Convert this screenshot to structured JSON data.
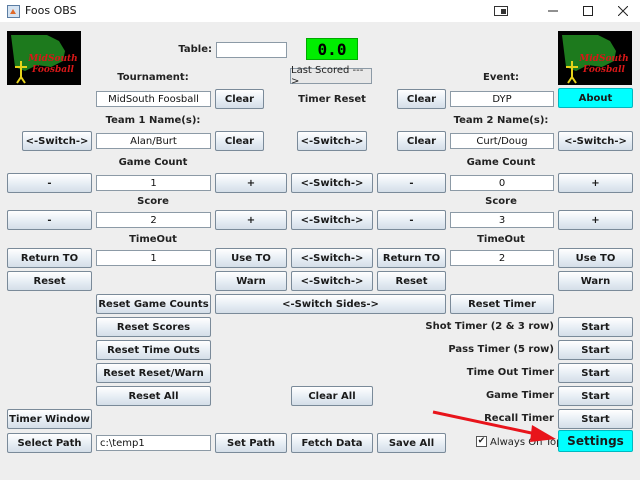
{
  "window": {
    "title": "Foos OBS"
  },
  "header": {
    "table_label": "Table:",
    "table_value": "",
    "score": "0.0",
    "tournament_label": "Tournament:",
    "event_label": "Event:",
    "last_scored": "Last Scored --->",
    "timer_reset": "Timer Reset",
    "about": "About"
  },
  "logo": {
    "line1": "MidSouth",
    "line2": "Foosball"
  },
  "tournament": {
    "value": "MidSouth Foosball",
    "clear": "Clear"
  },
  "event": {
    "clear": "Clear",
    "value": "DYP"
  },
  "team1": {
    "label": "Team 1 Name(s):",
    "switch": "<-Switch->",
    "value": "Alan/Burt",
    "clear": "Clear"
  },
  "team2": {
    "label": "Team 2 Name(s):",
    "switch": "<-Switch->",
    "value": "Curt/Doug",
    "clear": "Clear"
  },
  "center": {
    "switch_names": "<-Switch->"
  },
  "game_count": {
    "label1": "Game Count",
    "label2": "Game Count",
    "minus1": "-",
    "value1": "1",
    "plus1": "+",
    "switch": "<-Switch->",
    "minus2": "-",
    "value2": "0",
    "plus2": "+"
  },
  "score": {
    "label1": "Score",
    "label2": "Score",
    "minus1": "-",
    "value1": "2",
    "plus1": "+",
    "switch": "<-Switch->",
    "minus2": "-",
    "value2": "3",
    "plus2": "+"
  },
  "timeout": {
    "label1": "TimeOut",
    "label2": "TimeOut",
    "return1": "Return TO",
    "value1": "1",
    "use1": "Use TO",
    "switch": "<-Switch->",
    "return2": "Return TO",
    "value2": "2",
    "use2": "Use TO"
  },
  "row_reset": {
    "reset1": "Reset",
    "warn1": "Warn",
    "switch": "<-Switch->",
    "reset2": "Reset",
    "warn2": "Warn"
  },
  "bottom": {
    "reset_game_counts": "Reset Game Counts",
    "switch_sides": "<-Switch Sides->",
    "reset_timer": "Reset Timer",
    "reset_scores": "Reset Scores",
    "reset_time_outs": "Reset Time Outs",
    "reset_reset_warn": "Reset Reset/Warn",
    "reset_all": "Reset All",
    "clear_all": "Clear All",
    "timer_window": "Timer Window",
    "select_path": "Select Path",
    "path_value": "c:\\temp1",
    "set_path": "Set Path",
    "fetch_data": "Fetch Data",
    "save_all": "Save All",
    "always_on_top": "Always On Top",
    "always_on_top_checked": true,
    "settings": "Settings"
  },
  "timers": {
    "shot": "Shot Timer (2 & 3 row)",
    "pass": "Pass Timer (5 row)",
    "timeout": "Time Out Timer",
    "game": "Game Timer",
    "recall": "Recall Timer",
    "start": "Start"
  },
  "colors": {
    "score_bg": "#00ee00",
    "cyan": "#00ffff",
    "arrow": "#e8141b"
  }
}
